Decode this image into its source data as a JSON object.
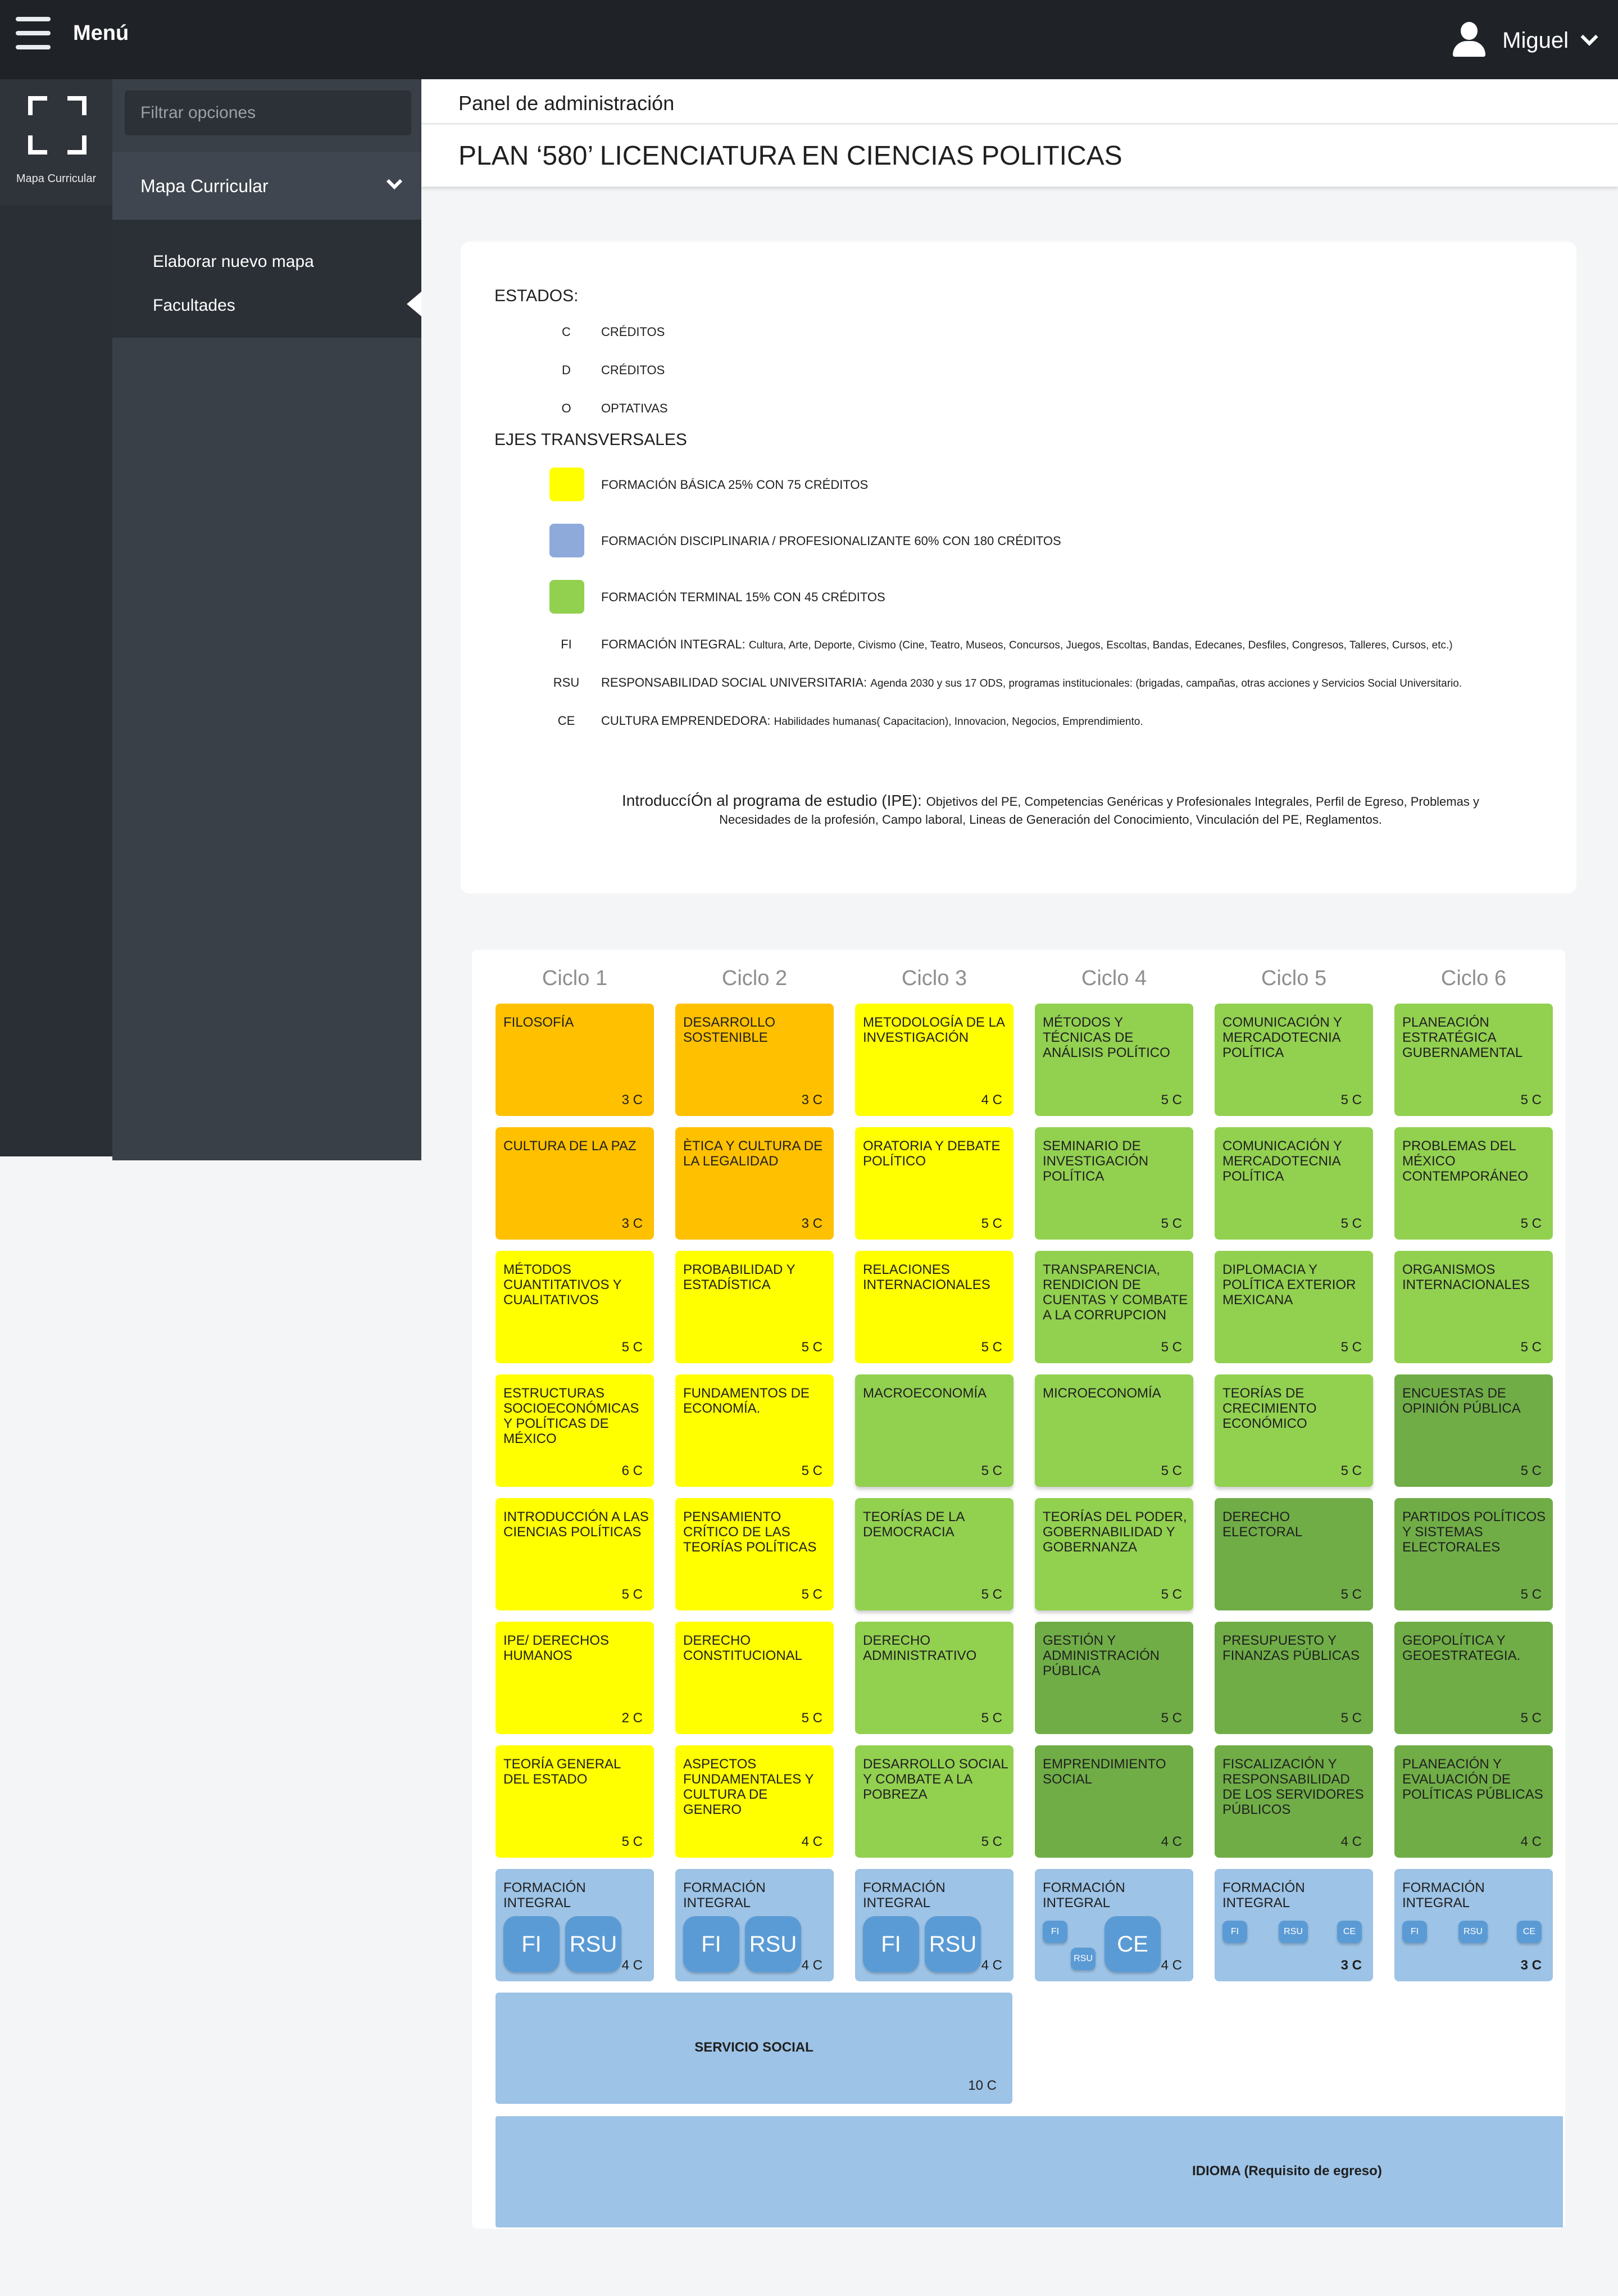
{
  "topbar": {
    "menu_label": "Menú",
    "user_name": "Miguel"
  },
  "rail": {
    "item_label": "Mapa Curricular"
  },
  "sidebar": {
    "filter_placeholder": "Filtrar opciones",
    "section_label": "Mapa Curricular",
    "items": [
      {
        "label": "Elaborar  nuevo mapa"
      },
      {
        "label": "Facultades"
      }
    ]
  },
  "header": {
    "panel_title": "Panel de administración",
    "plan_title": "PLAN  ‘580’ LICENCIATURA EN CIENCIAS POLITICAS"
  },
  "legend": {
    "estados_title": "ESTADOS:",
    "estados": [
      {
        "code": "C",
        "label": "CRÉDITOS"
      },
      {
        "code": "D",
        "label": "CRÉDITOS"
      },
      {
        "code": "O",
        "label": "OPTATIVAS"
      }
    ],
    "ejes_title": "EJES TRANSVERSALES",
    "ejes": [
      {
        "color": "#ffff00",
        "label": "FORMACIÓN BÁSICA 25% CON 75 CRÉDITOS"
      },
      {
        "color": "#8eaadb",
        "label": "FORMACIÓN DISCIPLINARIA / PROFESIONALIZANTE 60% CON 180 CRÉDITOS"
      },
      {
        "color": "#92d050",
        "label": "FORMACIÓN TERMINAL 15% CON 45 CRÉDITOS"
      }
    ],
    "integrales": [
      {
        "code": "FI",
        "label": "FORMACIÓN INTEGRAL:",
        "detail": "Cultura, Arte, Deporte, Civismo (Cine, Teatro, Museos, Concursos, Juegos, Escoltas, Bandas, Edecanes, Desfiles, Congresos, Talleres, Cursos, etc.)"
      },
      {
        "code": "RSU",
        "label": "RESPONSABILIDAD SOCIAL UNIVERSITARIA:",
        "detail": "Agenda 2030 y sus 17 ODS, programas institucionales: (brigadas, campañas, otras acciones y Servicios Social Universitario."
      },
      {
        "code": "CE",
        "label": "CULTURA EMPRENDEDORA:",
        "detail": "Habilidades humanas( Capacitacion), Innovacion, Negocios, Emprendimiento."
      }
    ],
    "ipe_label": "IntroduccíÓn al programa de estudio (IPE):",
    "ipe_detail": "Objetivos del PE, Competencias Genéricas y Profesionales Integrales, Perfil de Egreso, Problemas y Necesidades de la profesión, Campo laboral, Lineas de Generación del Conocimiento, Vinculación del PE, Reglamentos."
  },
  "colors": {
    "orange": "#ffc000",
    "yellow": "#ffff00",
    "light_green": "#92d050",
    "dark_green": "#70ad47",
    "blue": "#9dc3e6",
    "badge_blue": "#5b9bd5"
  },
  "map": {
    "cycles": [
      "Ciclo 1",
      "Ciclo 2",
      "Ciclo 3",
      "Ciclo 4",
      "Ciclo 5",
      "Ciclo 6"
    ],
    "courses": [
      [
        {
          "name": "FILOSOFÍA",
          "credits": "3 C",
          "color": "orange"
        },
        {
          "name": "DESARROLLO SOSTENIBLE",
          "credits": "3 C",
          "color": "orange"
        },
        {
          "name": "METODOLOGÍA DE LA INVESTIGACIÓN",
          "credits": "4 C",
          "color": "yellow"
        },
        {
          "name": "MÉTODOS Y TÉCNICAS DE ANÁLISIS POLÍTICO",
          "credits": "5 C",
          "color": "light_green"
        },
        {
          "name": "COMUNICACIÓN Y MERCADOTECNIA POLÍTICA",
          "credits": "5 C",
          "color": "light_green"
        },
        {
          "name": "PLANEACIÓN ESTRATÉGICA GUBERNAMENTAL",
          "credits": "5 C",
          "color": "light_green"
        }
      ],
      [
        {
          "name": "CULTURA DE LA PAZ",
          "credits": "3 C",
          "color": "orange"
        },
        {
          "name": "ÈTICA Y CULTURA DE LA LEGALIDAD",
          "credits": "3 C",
          "color": "orange"
        },
        {
          "name": "ORATORIA Y DEBATE POLÍTICO",
          "credits": "5 C",
          "color": "yellow"
        },
        {
          "name": "SEMINARIO DE INVESTIGACIÓN POLÍTICA",
          "credits": "5 C",
          "color": "light_green"
        },
        {
          "name": "COMUNICACIÓN Y MERCADOTECNIA POLÍTICA",
          "credits": "5 C",
          "color": "light_green"
        },
        {
          "name": "PROBLEMAS DEL MÉXICO CONTEMPORÁNEO",
          "credits": "5 C",
          "color": "light_green"
        }
      ],
      [
        {
          "name": "MÉTODOS CUANTITATIVOS Y CUALITATIVOS",
          "credits": "5 C",
          "color": "yellow"
        },
        {
          "name": "PROBABILIDAD Y ESTADÍSTICA",
          "credits": "5 C",
          "color": "yellow"
        },
        {
          "name": "RELACIONES INTERNACIONALES",
          "credits": "5 C",
          "color": "yellow"
        },
        {
          "name": "TRANSPARENCIA, RENDICION DE CUENTAS Y COMBATE A LA CORRUPCION",
          "credits": "5 C",
          "color": "light_green"
        },
        {
          "name": "DIPLOMACIA Y POLÍTICA EXTERIOR MEXICANA",
          "credits": "5 C",
          "color": "light_green"
        },
        {
          "name": "ORGANISMOS INTERNACIONALES",
          "credits": "5 C",
          "color": "light_green"
        }
      ],
      [
        {
          "name": "ESTRUCTURAS SOCIOECONÓMICAS Y POLÍTICAS DE MÉXICO",
          "credits": "6 C",
          "color": "yellow"
        },
        {
          "name": "FUNDAMENTOS DE ECONOMÍA.",
          "credits": "5 C",
          "color": "yellow"
        },
        {
          "name": "MACROECONOMÍA",
          "credits": "5 C",
          "color": "light_green"
        },
        {
          "name": "MICROECONOMÍA",
          "credits": "5 C",
          "color": "light_green"
        },
        {
          "name": "TEORÍAS DE CRECIMIENTO ECONÓMICO",
          "credits": "5 C",
          "color": "light_green"
        },
        {
          "name": "ENCUESTAS DE OPINIÓN PÚBLICA",
          "credits": "5 C",
          "color": "dark_green"
        }
      ],
      [
        {
          "name": "INTRODUCCIÓN A LAS CIENCIAS POLÍTICAS",
          "credits": "5 C",
          "color": "yellow"
        },
        {
          "name": "PENSAMIENTO CRÍTICO DE LAS TEORÍAS POLÍTICAS",
          "credits": "5 C",
          "color": "yellow"
        },
        {
          "name": "TEORÍAS DE LA DEMOCRACIA",
          "credits": "5 C",
          "color": "light_green"
        },
        {
          "name": "TEORÍAS DEL PODER, GOBERNABILIDAD Y GOBERNANZA",
          "credits": "5 C",
          "color": "light_green"
        },
        {
          "name": "DERECHO ELECTORAL",
          "credits": "5 C",
          "color": "dark_green"
        },
        {
          "name": "PARTIDOS POLÍTICOS Y SISTEMAS ELECTORALES",
          "credits": "5 C",
          "color": "dark_green"
        }
      ],
      [
        {
          "name": "IPE/ DERECHOS HUMANOS",
          "credits": "2 C",
          "color": "yellow"
        },
        {
          "name": "DERECHO CONSTITUCIONAL",
          "credits": "5 C",
          "color": "yellow"
        },
        {
          "name": "DERECHO ADMINISTRATIVO",
          "credits": "5 C",
          "color": "light_green"
        },
        {
          "name": "GESTIÓN Y ADMINISTRACIÓN PÚBLICA",
          "credits": "5 C",
          "color": "dark_green"
        },
        {
          "name": "PRESUPUESTO Y FINANZAS PÚBLICAS",
          "credits": "5 C",
          "color": "dark_green"
        },
        {
          "name": "GEOPOLÍTICA Y GEOESTRATEGIA.",
          "credits": "5 C",
          "color": "dark_green"
        }
      ],
      [
        {
          "name": "TEORÍA GENERAL DEL ESTADO",
          "credits": "5 C",
          "color": "yellow"
        },
        {
          "name": "ASPECTOS FUNDAMENTALES Y CULTURA  DE GENERO",
          "credits": "4 C",
          "color": "yellow"
        },
        {
          "name": "DESARROLLO SOCIAL Y COMBATE A LA POBREZA",
          "credits": "5 C",
          "color": "light_green"
        },
        {
          "name": "EMPRENDIMIENTO SOCIAL",
          "credits": "4 C",
          "color": "dark_green"
        },
        {
          "name": "FISCALIZACIÓN Y RESPONSABILIDAD DE LOS SERVIDORES PÚBLICOS",
          "credits": "4 C",
          "color": "dark_green"
        },
        {
          "name": "PLANEACIÓN Y EVALUACIÓN DE POLÍTICAS PÚBLICAS",
          "credits": "4 C",
          "color": "dark_green"
        }
      ]
    ],
    "formacion_integral": [
      {
        "name": "FORMACIÓN INTEGRAL",
        "credits": "4 C",
        "badges": [
          "FI",
          "RSU"
        ]
      },
      {
        "name": "FORMACIÓN INTEGRAL",
        "credits": "4 C",
        "badges": [
          "FI",
          "RSU"
        ]
      },
      {
        "name": "FORMACIÓN INTEGRAL",
        "credits": "4 C",
        "badges": [
          "FI",
          "RSU"
        ]
      },
      {
        "name": "FORMACIÓN INTEGRAL",
        "credits": "4 C",
        "badges": [
          "FI",
          "RSU",
          "CE"
        ]
      },
      {
        "name": "FORMACIÓN INTEGRAL",
        "credits": "3 C",
        "badges": [
          "FI",
          "RSU",
          "CE"
        ]
      },
      {
        "name": "FORMACIÓN INTEGRAL",
        "credits": "3 C",
        "badges": [
          "FI",
          "RSU",
          "CE"
        ]
      }
    ],
    "servicio_social": {
      "name": "SERVICIO SOCIAL",
      "credits": "10 C"
    },
    "idioma": {
      "name": "IDIOMA (Requisito de egreso)"
    }
  }
}
